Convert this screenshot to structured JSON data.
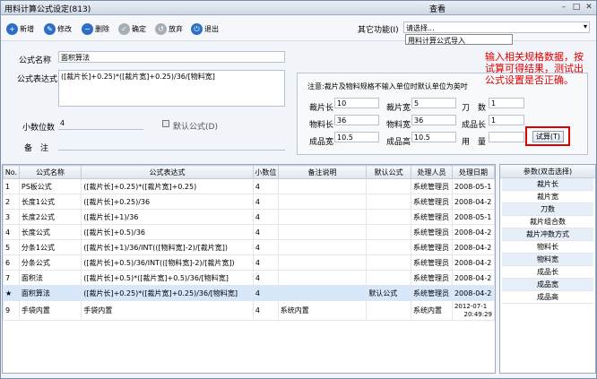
{
  "window": {
    "title": "用料计算公式设定(813)",
    "view_label": "查看",
    "min": "–",
    "max": "□",
    "close": "✕"
  },
  "toolbar": {
    "new": "新增",
    "edit": "修改",
    "delete": "删除",
    "confirm": "确定",
    "discard": "放弃",
    "exit": "退出"
  },
  "other": {
    "label": "其它功能(I)",
    "select_value": "请选择...",
    "dropdown_item": "用料计算公式导入"
  },
  "form": {
    "name_label": "公式名称",
    "name_value": "面积算法",
    "expr_label": "公式表达式",
    "expr_value": "([裁片长]+0.25)*([裁片宽]+0.25)/36/[物料宽]",
    "decimal_label": "小数位数",
    "decimal_value": "4",
    "default_label": "默认公式(D)",
    "remark_label": "备　注",
    "remark_value": ""
  },
  "tester": {
    "note": "注意:裁片及物料规格不输入单位时默认单位为英吋",
    "f1_label": "裁片长",
    "f1_value": "10",
    "f2_label": "裁片宽",
    "f2_value": "5",
    "f3_label": "刀　数",
    "f3_value": "1",
    "f4_label": "物料长",
    "f4_value": "36",
    "f5_label": "物料宽",
    "f5_value": "36",
    "f6_label": "成品长",
    "f6_value": "1",
    "f7_label": "成品宽",
    "f7_value": "10.5",
    "f8_label": "成品高",
    "f8_value": "10.5",
    "f9_label": "用　量",
    "f9_value": "",
    "calc_button": "试算(T)"
  },
  "annotation": "输入相关规格数据，按试算可得结果，测试出公式设置是否正确。",
  "table": {
    "headers": [
      "No.",
      "公式名称",
      "公式表达式",
      "小数位",
      "备注说明",
      "默认公式",
      "处理人员",
      "处理日期"
    ],
    "rows": [
      {
        "no": "1",
        "name": "PS板公式",
        "expr": "([裁片长]+0.25)*([裁片宽]+0.25)",
        "dec": "4",
        "remark": "",
        "def": "",
        "user": "系统管理员",
        "date": "2008-05-1"
      },
      {
        "no": "2",
        "name": "长度1公式",
        "expr": "([裁片长]+0.25)/36",
        "dec": "4",
        "remark": "",
        "def": "",
        "user": "系统管理员",
        "date": "2008-04-2"
      },
      {
        "no": "3",
        "name": "长度2公式",
        "expr": "([裁片长]+1)/36",
        "dec": "4",
        "remark": "",
        "def": "",
        "user": "系统管理员",
        "date": "2008-05-1"
      },
      {
        "no": "4",
        "name": "长度公式",
        "expr": "([裁片长]+0.5)/36",
        "dec": "4",
        "remark": "",
        "def": "",
        "user": "系统管理员",
        "date": "2008-04-2"
      },
      {
        "no": "5",
        "name": "分条1公式",
        "expr": "([裁片长]+1)/36/INT(([物料宽]-2)/[裁片宽])",
        "dec": "4",
        "remark": "",
        "def": "",
        "user": "系统管理员",
        "date": "2008-04-2"
      },
      {
        "no": "6",
        "name": "分条公式",
        "expr": "([裁片长]+0.5)/36/INT(([物料宽]-2)/[裁片宽])",
        "dec": "4",
        "remark": "",
        "def": "",
        "user": "系统管理员",
        "date": "2008-04-2"
      },
      {
        "no": "7",
        "name": "面积法",
        "expr": "([裁片长]+0.5)*([裁片宽]+0.5)/36/[物料宽]",
        "dec": "4",
        "remark": "",
        "def": "",
        "user": "系统管理员",
        "date": "2008-04-2"
      },
      {
        "no": "★",
        "name": "面积算法",
        "expr": "([裁片长]+0.25)*([裁片宽]+0.25)/36/[物料宽]",
        "dec": "4",
        "remark": "",
        "def": "默认公式",
        "user": "系统管理员",
        "date": "2008-04-2"
      },
      {
        "no": "9",
        "name": "手袋内置",
        "expr": "手袋内置",
        "dec": "4",
        "remark": "系统内置",
        "def": "",
        "user": "系统内置",
        "date": "2012-07-1",
        "time": "20:49:29"
      }
    ]
  },
  "params": {
    "header": "参数(双击选择)",
    "items": [
      "裁片长",
      "裁片宽",
      "刀数",
      "裁片组合数",
      "裁片冲数方式",
      "物料长",
      "物料宽",
      "成品长",
      "成品宽",
      "成品高"
    ]
  },
  "colors": {
    "accent": "#2d6fc7",
    "annotation": "#e00000",
    "selected_row": "#d7e7fa"
  }
}
